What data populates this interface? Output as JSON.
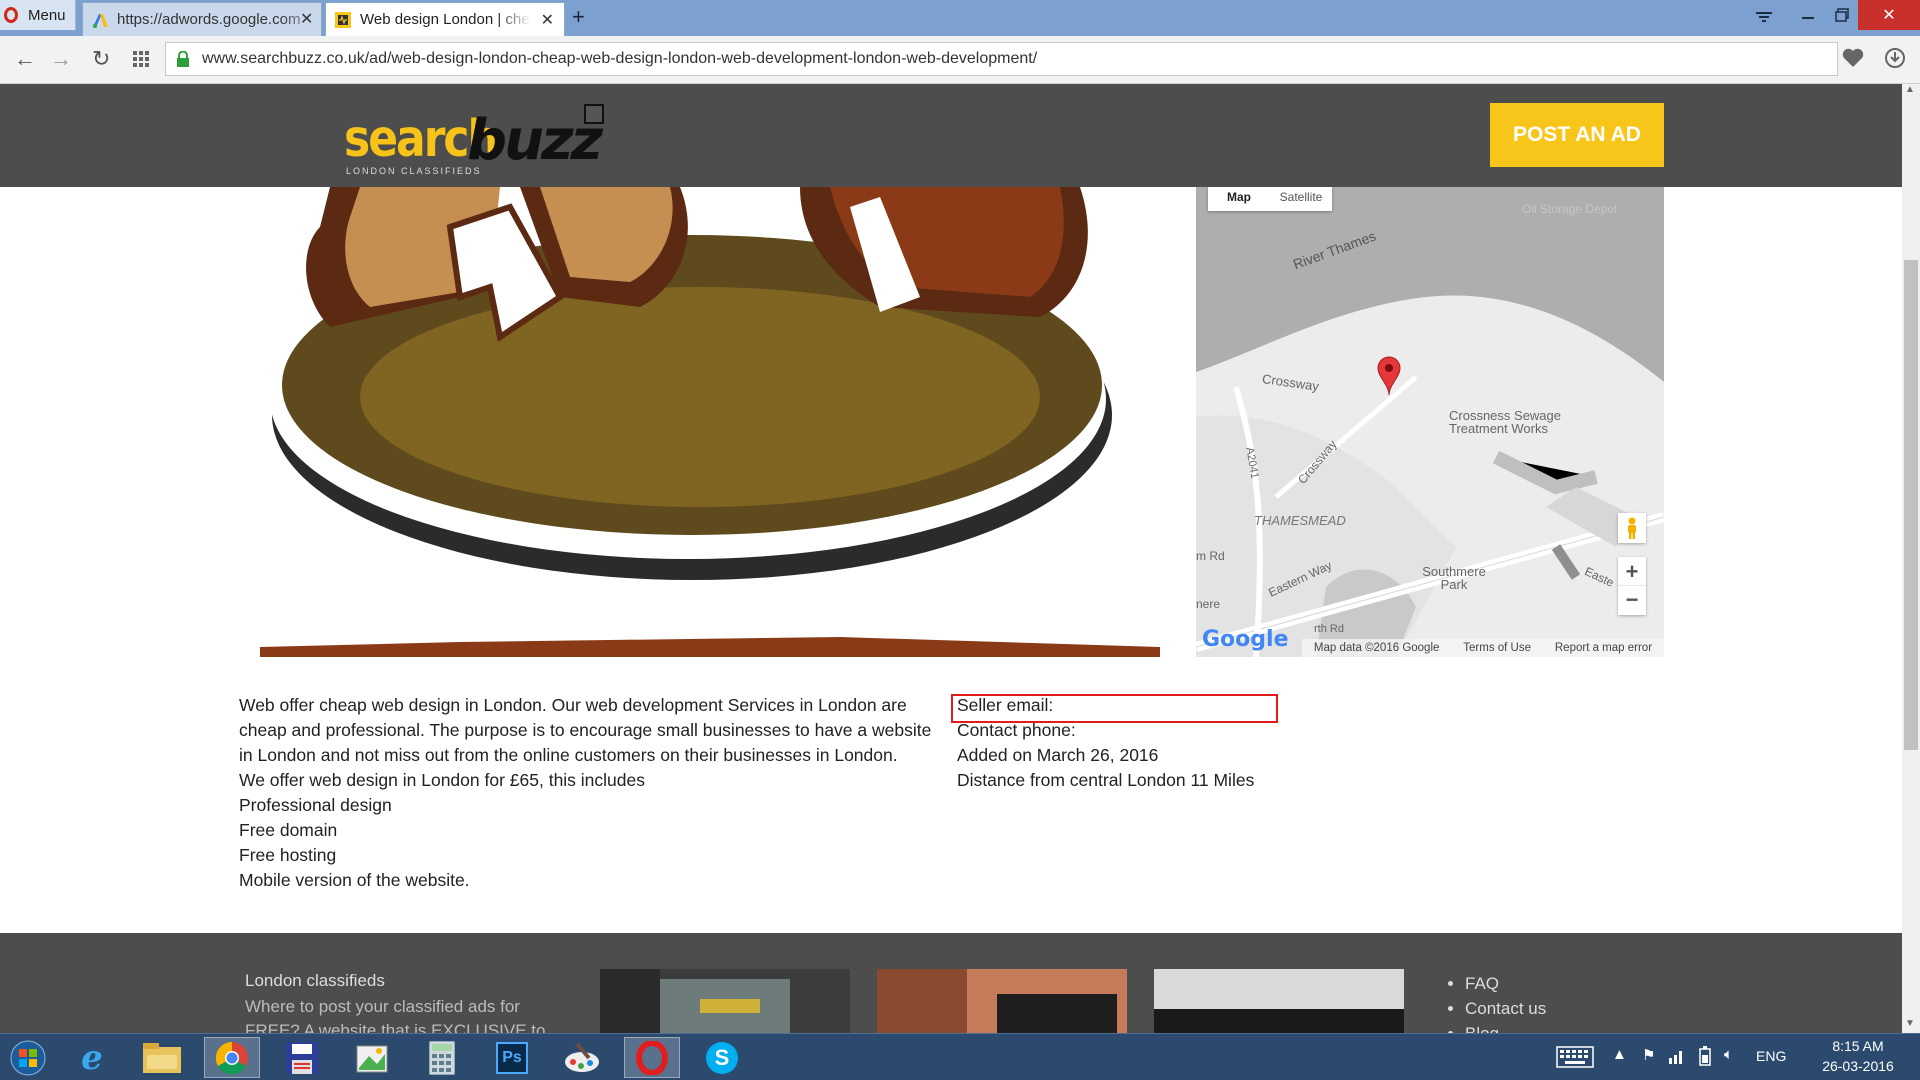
{
  "browser": {
    "menu_label": "Menu",
    "tabs": [
      {
        "title": "https://adwords.google.com",
        "active": false
      },
      {
        "title": "Web design London | cheap web design",
        "active": true
      }
    ],
    "new_tab_symbol": "+",
    "url": "www.searchbuzz.co.uk/ad/web-design-london-cheap-web-design-london-web-development-london-web-development/"
  },
  "site": {
    "logo_word1": "search",
    "logo_word2": "buzz",
    "logo_tagline": "LONDON CLASSIFIEDS",
    "post_ad_label": "POST AN AD",
    "accent_color": "#f8c61b"
  },
  "map": {
    "type_buttons": [
      "Map",
      "Satellite"
    ],
    "labels": [
      "River Thames",
      "Crossway",
      "Crossness Sewage Treatment Works",
      "A2041",
      "Crossway",
      "THAMESMEAD",
      "Eastern Way",
      "Southmere Park",
      "m Rd",
      "nere",
      "rth Rd",
      "Easte",
      "Oil Storage Depot"
    ],
    "google_logo": "Google",
    "map_data": "Map data ©2016 Google",
    "terms": "Terms of Use",
    "report": "Report a map error",
    "zoom_in": "+",
    "zoom_out": "−"
  },
  "description": [
    "Web offer cheap web design in London. Our web development Services in London are cheap and professional. The purpose is to encourage small businesses to have a website in London and not miss out from the online customers on their businesses in London.",
    "We offer web design in London for £65, this includes",
    "Professional design",
    "Free domain",
    "Free hosting",
    "Mobile version of the website."
  ],
  "seller": {
    "email_label": "Seller email:",
    "phone_label": "Contact phone:",
    "added": "Added on March 26, 2016",
    "distance": "Distance from central London 11 Miles"
  },
  "footer": {
    "heading": "London classifieds",
    "text": "Where to post your classified ads for FREE? A website that is EXCLUSIVE to",
    "links": [
      "FAQ",
      "Contact us",
      "Blog"
    ]
  },
  "taskbar": {
    "language": "ENG",
    "time": "8:15 AM",
    "date": "26-03-2016"
  }
}
